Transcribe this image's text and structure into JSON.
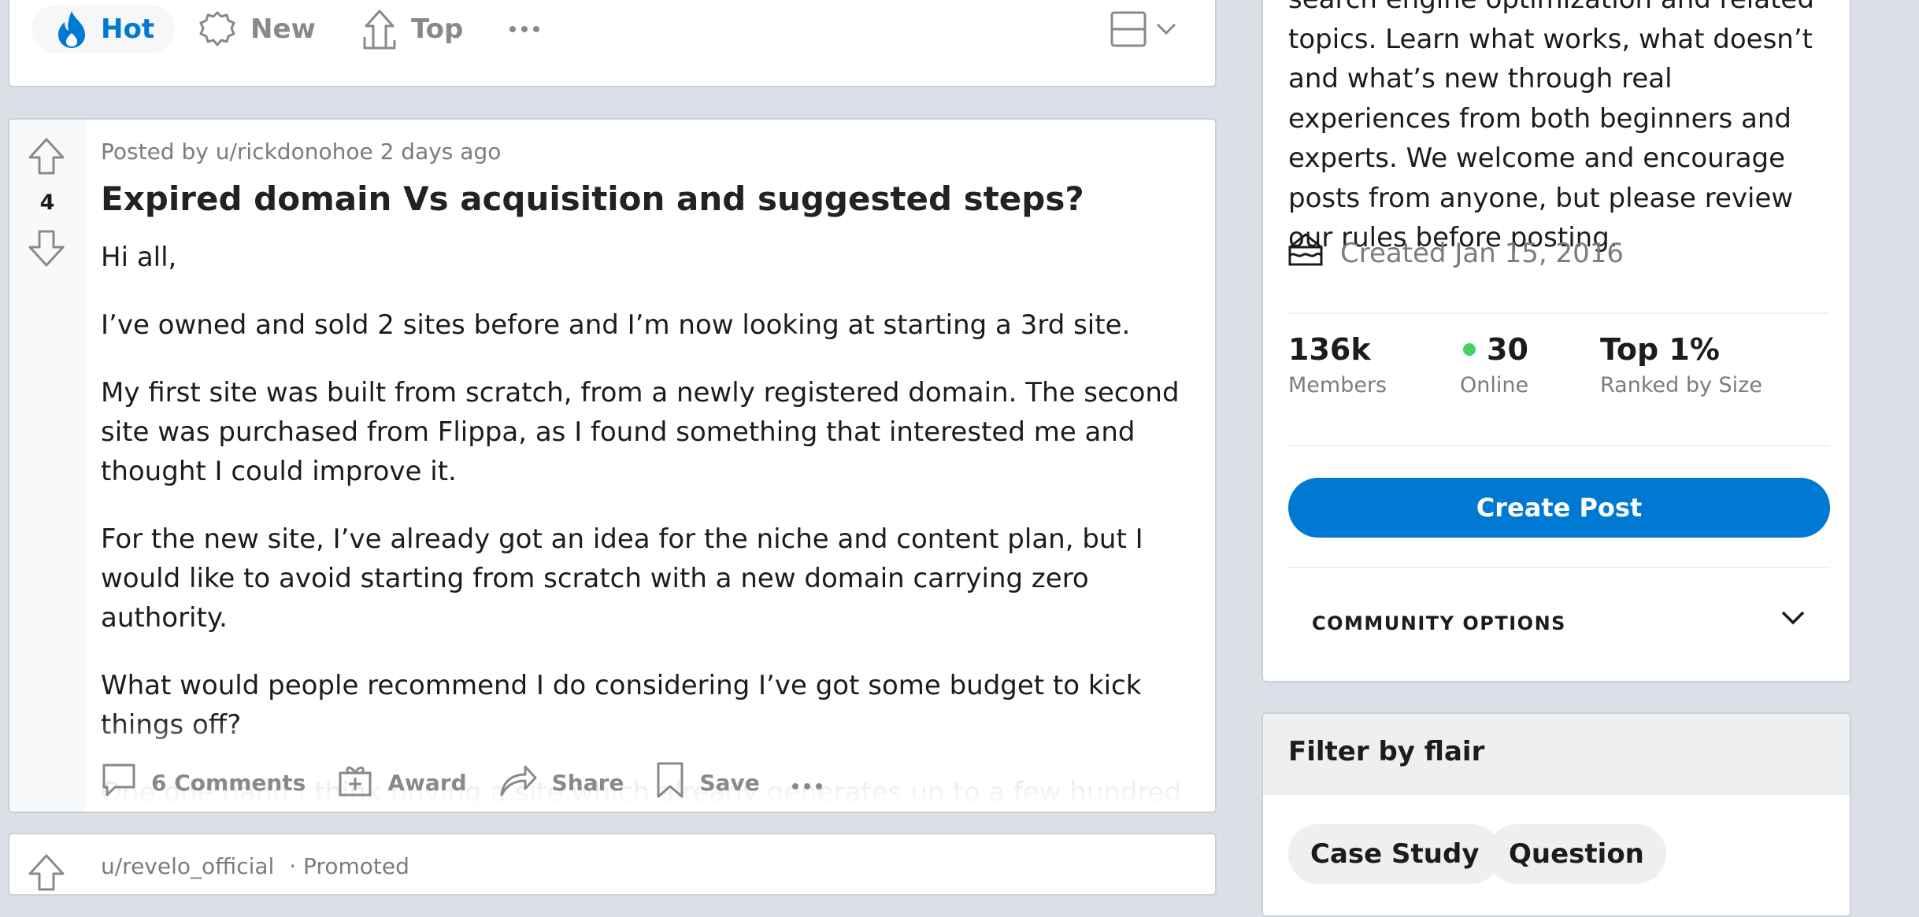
{
  "sort_bar": {
    "hot_label": "Hot",
    "new_label": "New",
    "top_label": "Top",
    "active": "Hot"
  },
  "post": {
    "votes": "4",
    "meta": "Posted by u/rickdonohoe 2 days ago",
    "title": "Expired domain Vs acquisition and suggested steps?",
    "paragraphs": [
      "Hi all,",
      "I’ve owned and sold 2 sites before and I’m now looking at starting a 3rd site.",
      "My first site was built from scratch, from a newly registered domain. The second site was purchased from Flippa, as I found something that interested me and thought I could improve it.",
      "For the new site, I’ve already got an idea for the niche and content plan, but I would like to avoid starting from scratch with a new domain carrying zero authority.",
      "What would people recommend I do considering I’ve got some budget to kick things off?",
      "One one hand I think buying a site which already generates up to a few hundred per"
    ],
    "actions": {
      "comments": "6 Comments",
      "award": "Award",
      "share": "Share",
      "save": "Save"
    }
  },
  "promoted": {
    "user": "u/revelo_official",
    "tag": "· Promoted"
  },
  "sidebar": {
    "description": "search engine optimization and related topics. Learn what works, what doesn’t and what’s new through real experiences from both beginners and experts. We welcome and encourage posts from anyone, but please review our rules before posting.",
    "created": "Created Jan 15, 2016",
    "stats": {
      "members_value": "136k",
      "members_label": "Members",
      "online_value": "30",
      "online_label": "Online",
      "rank_value": "Top 1%",
      "rank_label": "Ranked by Size"
    },
    "create_post_label": "Create Post",
    "community_options_label": "COMMUNITY OPTIONS"
  },
  "flair": {
    "title": "Filter by flair",
    "items": [
      "Case Study",
      "Question"
    ]
  },
  "colors": {
    "accent": "#0079d3",
    "online": "#46d160",
    "background": "#dae0e6"
  }
}
